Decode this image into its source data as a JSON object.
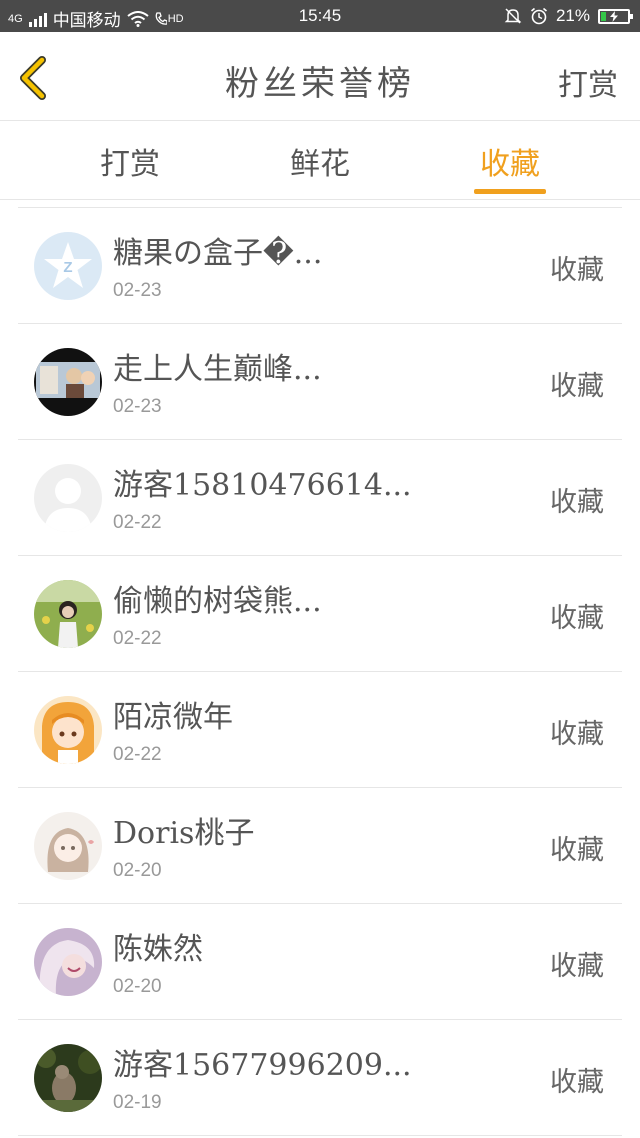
{
  "status_bar": {
    "network": "4G",
    "carrier": "中国移动",
    "hd": "HD",
    "time": "15:45",
    "battery": "21%",
    "battery_level": 0.21,
    "icons": [
      "signal-icon",
      "wifi-icon",
      "hd-call-icon",
      "mute-icon",
      "alarm-icon",
      "battery-icon"
    ]
  },
  "header": {
    "back_icon": "chevron-left-icon",
    "title": "粉丝荣誉榜",
    "right_action": "打赏"
  },
  "tabs": [
    {
      "label": "打赏",
      "active": false
    },
    {
      "label": "鲜花",
      "active": false
    },
    {
      "label": "收藏",
      "active": true
    }
  ],
  "accent_color": "#f0a01e",
  "fans": [
    {
      "name": "糖果の盒子�...",
      "date": "02-23",
      "action": "收藏",
      "avatar": "qq-logo-avatar"
    },
    {
      "name": "走上人生巅峰...",
      "date": "02-23",
      "action": "收藏",
      "avatar": "photo-avatar"
    },
    {
      "name": "游客15810476614...",
      "date": "02-22",
      "action": "收藏",
      "avatar": "default-avatar"
    },
    {
      "name": "偷懒的树袋熊...",
      "date": "02-22",
      "action": "收藏",
      "avatar": "girl-field-avatar"
    },
    {
      "name": "陌凉微年",
      "date": "02-22",
      "action": "收藏",
      "avatar": "anime-girl-avatar"
    },
    {
      "name": "Doris桃子",
      "date": "02-20",
      "action": "收藏",
      "avatar": "sketch-girl-avatar"
    },
    {
      "name": "陈姝然",
      "date": "02-20",
      "action": "收藏",
      "avatar": "portrait-avatar"
    },
    {
      "name": "游客15677996209...",
      "date": "02-19",
      "action": "收藏",
      "avatar": "animal-avatar"
    }
  ]
}
